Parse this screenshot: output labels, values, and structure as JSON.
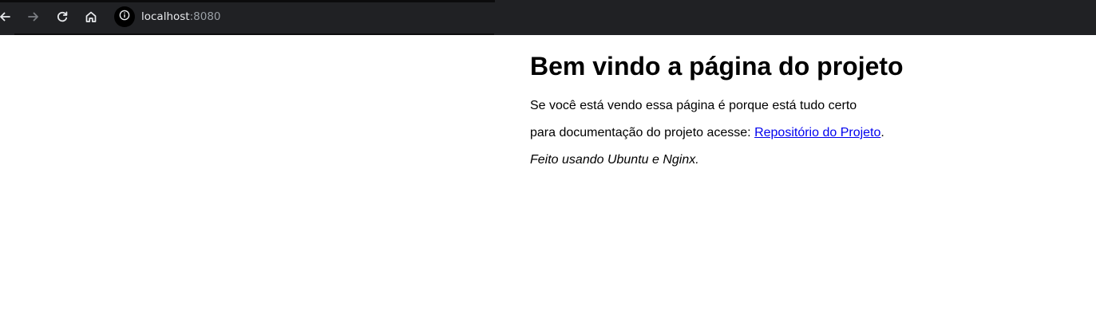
{
  "browser": {
    "url_host": "localhost",
    "url_port": ":8080",
    "icons": {
      "back": "arrow-left-icon",
      "forward": "arrow-right-icon",
      "reload": "reload-icon",
      "home": "home-icon",
      "site_info": "info-icon"
    },
    "colors": {
      "toolbar": "#202124",
      "url_text": "#e8eaed",
      "port_text": "#9aa0a6"
    }
  },
  "page": {
    "heading": "Bem vindo a página do projeto",
    "line1": "Se você está vendo essa página é porque está tudo certo",
    "line2_prefix": "para documentação do projeto acesse: ",
    "link_text": "Repositório do Projeto",
    "line2_suffix": ".",
    "footer_note": "Feito usando Ubuntu e Nginx.",
    "colors": {
      "link": "#0000ee",
      "text": "#000000"
    }
  }
}
